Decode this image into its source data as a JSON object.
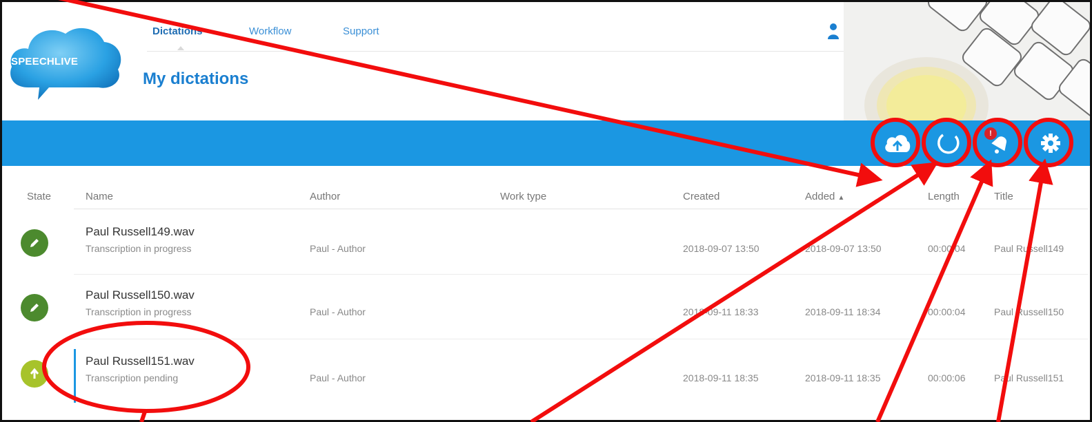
{
  "app": {
    "logo_text": "SPEECHLIVE"
  },
  "nav": {
    "items": [
      {
        "label": "Dictations",
        "active": true
      },
      {
        "label": "Workflow",
        "active": false
      },
      {
        "label": "Support",
        "active": false
      }
    ]
  },
  "page": {
    "title": "My dictations"
  },
  "toolbar": {
    "buttons": [
      {
        "icon": "cloud-upload-icon"
      },
      {
        "icon": "refresh-icon"
      },
      {
        "icon": "bell-icon",
        "badge": "!"
      },
      {
        "icon": "gear-icon"
      }
    ],
    "color": "#1b97e2"
  },
  "table": {
    "headers": {
      "state": "State",
      "name": "Name",
      "author": "Author",
      "work_type": "Work type",
      "created": "Created",
      "added": "Added",
      "length": "Length",
      "title": "Title"
    },
    "rows": [
      {
        "state_icon": "pencil-icon",
        "state_color": "#4c8a2e",
        "name": "Paul Russell149.wav",
        "status": "Transcription in progress",
        "author": "Paul - Author",
        "work_type": "",
        "created": "2018-09-07 13:50",
        "added": "2018-09-07 13:50",
        "length": "00:00:04",
        "title": "Paul Russell149"
      },
      {
        "state_icon": "pencil-icon",
        "state_color": "#4c8a2e",
        "name": "Paul Russell150.wav",
        "status": "Transcription in progress",
        "author": "Paul - Author",
        "work_type": "",
        "created": "2018-09-11 18:33",
        "added": "2018-09-11 18:34",
        "length": "00:00:04",
        "title": "Paul Russell150"
      },
      {
        "state_icon": "arrow-up-icon",
        "state_color": "#a7c32b",
        "name": "Paul Russell151.wav",
        "status": "Transcription pending",
        "author": "Paul - Author",
        "work_type": "",
        "created": "2018-09-11 18:35",
        "added": "2018-09-11 18:35",
        "length": "00:00:06",
        "title": "Paul Russell151"
      }
    ]
  },
  "annotation_color": "#f20d0d"
}
